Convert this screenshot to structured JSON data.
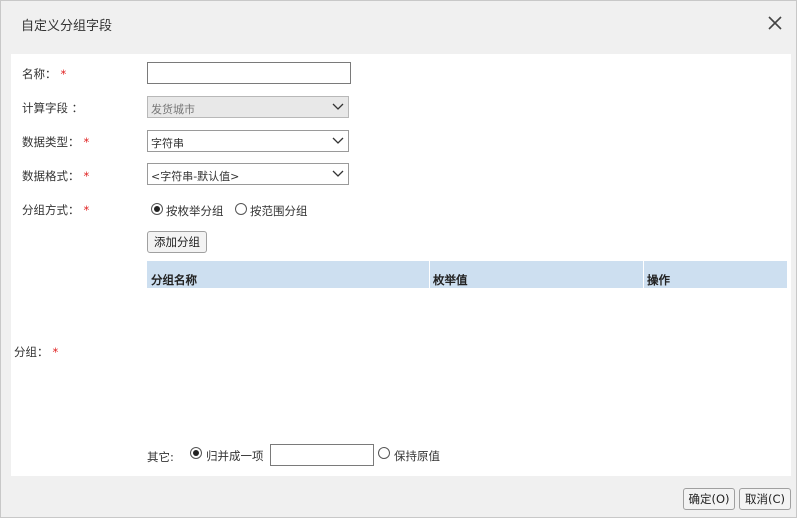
{
  "dialog": {
    "title": "自定义分组字段",
    "close_icon": "close-icon"
  },
  "form": {
    "name_label": "名称：",
    "name_value": "",
    "calc_field_label": "计算字段 ：",
    "calc_field_value": "发货城市",
    "data_type_label": "数据类型：",
    "data_type_value": "字符串",
    "data_format_label": "数据格式：",
    "data_format_value": "<字符串-默认值>",
    "group_method_label": "分组方式：",
    "group_method_options": [
      {
        "label": "按枚举分组",
        "checked": true
      },
      {
        "label": "按范围分组",
        "checked": false
      }
    ],
    "add_group_button": "添加分组",
    "group_label": "分组：",
    "required_mark": "*"
  },
  "table": {
    "columns": [
      "分组名称",
      "枚举值",
      "操作"
    ],
    "rows": []
  },
  "other": {
    "label": "其它:",
    "options": [
      {
        "label": "归并成一项",
        "checked": true
      },
      {
        "label": "保持原值",
        "checked": false
      }
    ],
    "merge_value": ""
  },
  "footer": {
    "ok_label": "确定(O)",
    "cancel_label": "取消(C)"
  },
  "colors": {
    "header_bg": "#cddff0",
    "required": "#e02020",
    "dialog_bg": "#f0f0f0"
  }
}
